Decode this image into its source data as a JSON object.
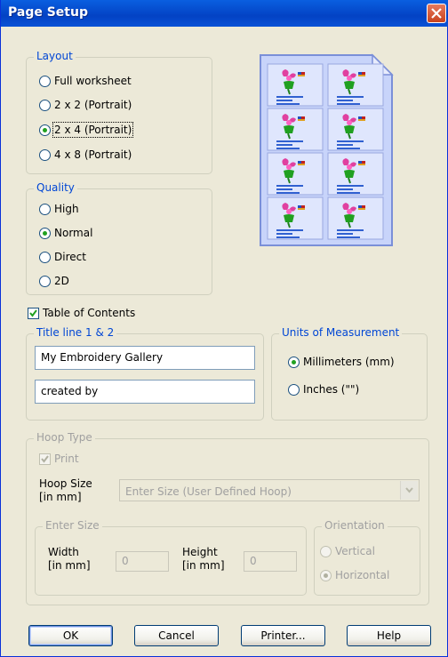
{
  "window": {
    "title": "Page Setup"
  },
  "layout": {
    "legend": "Layout",
    "options": [
      {
        "label": "Full worksheet",
        "checked": false
      },
      {
        "label": "2 x 2 (Portrait)",
        "checked": false
      },
      {
        "label": "2 x 4 (Portrait)",
        "checked": true
      },
      {
        "label": "4 x 8 (Portrait)",
        "checked": false
      }
    ]
  },
  "quality": {
    "legend": "Quality",
    "options": [
      {
        "label": "High",
        "checked": false
      },
      {
        "label": "Normal",
        "checked": true
      },
      {
        "label": "Direct",
        "checked": false
      },
      {
        "label": "2D",
        "checked": false
      }
    ]
  },
  "toc": {
    "label": "Table of Contents",
    "checked": true
  },
  "title_lines": {
    "legend": "Title line 1 & 2",
    "line1": "My Embroidery Gallery",
    "line2": "created by"
  },
  "units": {
    "legend": "Units of Measurement",
    "options": [
      {
        "label": "Millimeters (mm)",
        "checked": true
      },
      {
        "label": "Inches (\"\")",
        "checked": false
      }
    ]
  },
  "hoop": {
    "legend": "Hoop Type",
    "print_label": "Print",
    "print_checked": true,
    "size_label": "Hoop Size\n[in mm]",
    "size_value": "Enter Size (User Defined Hoop)"
  },
  "enter_size": {
    "legend": "Enter Size",
    "width_label": "Width\n[in mm]",
    "width_value": "0",
    "height_label": "Height\n[in mm]",
    "height_value": "0"
  },
  "orientation": {
    "legend": "Orientation",
    "options": [
      {
        "label": "Vertical",
        "checked": false
      },
      {
        "label": "Horizontal",
        "checked": true
      }
    ]
  },
  "buttons": {
    "ok": "OK",
    "cancel": "Cancel",
    "printer": "Printer...",
    "help": "Help"
  },
  "colors": {
    "titlebar": "#0a5fe0",
    "legend": "#0046d5",
    "radio_dot": "#21a121"
  }
}
